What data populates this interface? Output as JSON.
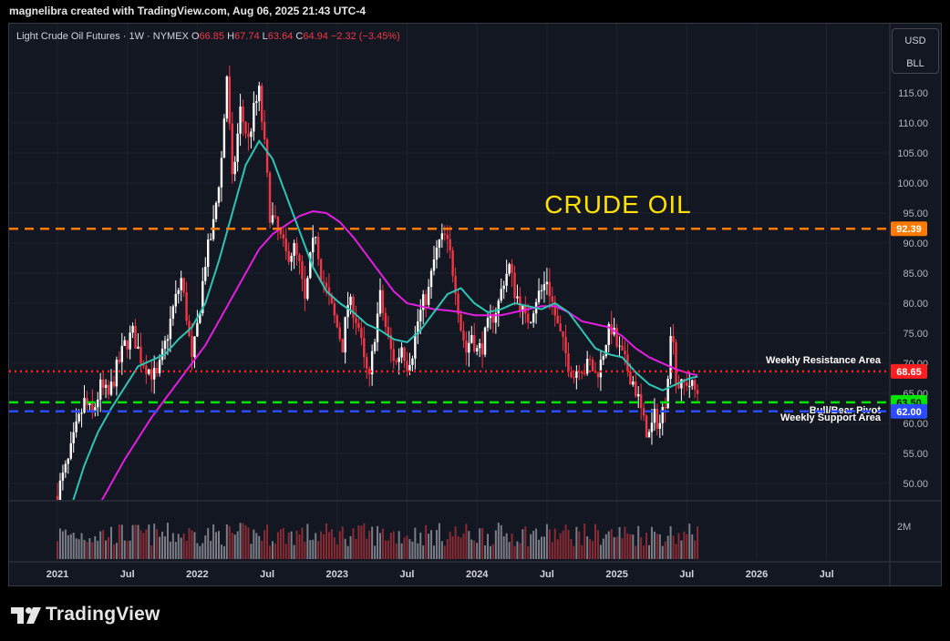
{
  "header": {
    "attribution": "magnelibra created with TradingView.com, Aug 06, 2025 21:43 UTC-4"
  },
  "legend": {
    "symbol": "Light Crude Oil Futures · 1W · NYMEX",
    "o_label": "O",
    "o_value": "66.85",
    "h_label": "H",
    "h_value": "67.74",
    "l_label": "L",
    "l_value": "63.64",
    "c_label": "C",
    "c_value": "64.94",
    "change": "−2.32 (−3.45%)"
  },
  "units": {
    "currency": "USD",
    "unit": "BLL"
  },
  "footer": {
    "brand": "TradingView"
  },
  "colors": {
    "background": "#131722",
    "up": "#ffffff",
    "down": "#f23645",
    "ema_fast": "#2ec4b6",
    "ema_slow": "#e31ee0",
    "level_orange": "#ff7a00",
    "level_red": "#ff1e1e",
    "level_green": "#00e600",
    "level_blue": "#2a4bff",
    "title": "#ffe100"
  },
  "chart_data": {
    "type": "candlestick",
    "title": "CRUDE OIL",
    "y_ticks": [
      "50.00",
      "55.00",
      "60.00",
      "65.00",
      "70.00",
      "75.00",
      "80.00",
      "85.00",
      "90.00",
      "95.00",
      "100.00",
      "105.00",
      "110.00",
      "115.00"
    ],
    "ylim": [
      47.5,
      122.5
    ],
    "x_ticks": [
      {
        "label": "2021",
        "t": 0
      },
      {
        "label": "Jul",
        "t": 26
      },
      {
        "label": "2022",
        "t": 52
      },
      {
        "label": "Jul",
        "t": 78
      },
      {
        "label": "2023",
        "t": 104
      },
      {
        "label": "Jul",
        "t": 130
      },
      {
        "label": "2024",
        "t": 156
      },
      {
        "label": "Jul",
        "t": 182
      },
      {
        "label": "2025",
        "t": 208
      },
      {
        "label": "Jul",
        "t": 234
      },
      {
        "label": "2026",
        "t": 260
      },
      {
        "label": "Jul",
        "t": 286
      }
    ],
    "x_unit": "weeks since Jan 2021",
    "levels": [
      {
        "value": 92.39,
        "label": "92.39",
        "style": "dashed",
        "color": "#ff7a00",
        "text": ""
      },
      {
        "value": 68.65,
        "label": "68.65",
        "style": "dotted",
        "color": "#ff1e1e",
        "text": "Weekly Resistance Area"
      },
      {
        "value": 63.5,
        "label": "63.50",
        "style": "dashed",
        "color": "#00e600",
        "text": "Bull/Bear Pivot"
      },
      {
        "value": 62.0,
        "label": "62.00",
        "style": "dashed",
        "color": "#2a4bff",
        "text": "Weekly Support Area"
      }
    ],
    "close_anchors": [
      [
        0,
        48.5
      ],
      [
        4,
        53.5
      ],
      [
        7,
        59.0
      ],
      [
        10,
        63.5
      ],
      [
        13,
        61.5
      ],
      [
        16,
        66.0
      ],
      [
        19,
        64.5
      ],
      [
        22,
        69.0
      ],
      [
        25,
        73.0
      ],
      [
        28,
        75.0
      ],
      [
        31,
        71.0
      ],
      [
        34,
        69.0
      ],
      [
        37,
        67.5
      ],
      [
        40,
        73.0
      ],
      [
        43,
        79.0
      ],
      [
        46,
        84.0
      ],
      [
        48,
        78.0
      ],
      [
        50,
        70.0
      ],
      [
        52,
        76.0
      ],
      [
        55,
        87.0
      ],
      [
        58,
        93.0
      ],
      [
        61,
        104.0
      ],
      [
        63,
        118.0
      ],
      [
        65,
        100.0
      ],
      [
        68,
        112.0
      ],
      [
        71,
        107.0
      ],
      [
        73,
        112.0
      ],
      [
        75,
        115.0
      ],
      [
        77,
        106.0
      ],
      [
        79,
        95.0
      ],
      [
        82,
        92.0
      ],
      [
        85,
        88.0
      ],
      [
        88,
        89.0
      ],
      [
        90,
        86.0
      ],
      [
        92,
        80.0
      ],
      [
        94,
        87.0
      ],
      [
        96,
        92.0
      ],
      [
        98,
        85.0
      ],
      [
        100,
        82.0
      ],
      [
        102,
        79.0
      ],
      [
        104,
        76.0
      ],
      [
        106,
        73.0
      ],
      [
        108,
        80.0
      ],
      [
        110,
        79.0
      ],
      [
        112,
        76.0
      ],
      [
        114,
        70.0
      ],
      [
        116,
        67.0
      ],
      [
        118,
        75.0
      ],
      [
        120,
        81.0
      ],
      [
        122,
        76.0
      ],
      [
        124,
        72.0
      ],
      [
        126,
        70.0
      ],
      [
        128,
        73.0
      ],
      [
        130,
        70.0
      ],
      [
        132,
        72.0
      ],
      [
        134,
        77.0
      ],
      [
        136,
        80.0
      ],
      [
        138,
        82.0
      ],
      [
        140,
        87.0
      ],
      [
        142,
        90.0
      ],
      [
        144,
        91.0
      ],
      [
        146,
        88.0
      ],
      [
        148,
        83.0
      ],
      [
        150,
        76.0
      ],
      [
        152,
        72.0
      ],
      [
        154,
        75.0
      ],
      [
        156,
        72.0
      ],
      [
        158,
        73.0
      ],
      [
        160,
        76.0
      ],
      [
        162,
        78.0
      ],
      [
        164,
        80.0
      ],
      [
        166,
        84.0
      ],
      [
        168,
        86.0
      ],
      [
        170,
        82.0
      ],
      [
        172,
        80.0
      ],
      [
        174,
        77.0
      ],
      [
        176,
        78.0
      ],
      [
        178,
        81.0
      ],
      [
        180,
        82.0
      ],
      [
        182,
        84.0
      ],
      [
        184,
        80.0
      ],
      [
        186,
        76.0
      ],
      [
        188,
        73.0
      ],
      [
        190,
        70.0
      ],
      [
        192,
        68.0
      ],
      [
        194,
        70.0
      ],
      [
        196,
        69.0
      ],
      [
        198,
        70.0
      ],
      [
        200,
        68.0
      ],
      [
        202,
        70.0
      ],
      [
        204,
        74.0
      ],
      [
        206,
        76.0
      ],
      [
        208,
        73.0
      ],
      [
        210,
        71.0
      ],
      [
        212,
        69.0
      ],
      [
        214,
        67.0
      ],
      [
        216,
        64.0
      ],
      [
        218,
        60.0
      ],
      [
        220,
        58.0
      ],
      [
        222,
        61.0
      ],
      [
        224,
        60.0
      ],
      [
        226,
        64.0
      ],
      [
        228,
        74.0
      ],
      [
        229,
        75.0
      ],
      [
        230,
        67.0
      ],
      [
        232,
        66.0
      ],
      [
        234,
        67.0
      ],
      [
        236,
        66.0
      ],
      [
        238,
        64.9
      ]
    ],
    "ema_fast_anchors": [
      [
        5,
        46.0
      ],
      [
        10,
        53.0
      ],
      [
        15,
        58.5
      ],
      [
        20,
        62.5
      ],
      [
        25,
        66.0
      ],
      [
        30,
        69.5
      ],
      [
        35,
        70.5
      ],
      [
        40,
        71.5
      ],
      [
        45,
        74.0
      ],
      [
        50,
        76.0
      ],
      [
        55,
        80.0
      ],
      [
        60,
        87.0
      ],
      [
        65,
        95.0
      ],
      [
        70,
        103.0
      ],
      [
        75,
        107.0
      ],
      [
        80,
        104.0
      ],
      [
        85,
        98.0
      ],
      [
        90,
        92.0
      ],
      [
        95,
        86.0
      ],
      [
        100,
        82.0
      ],
      [
        105,
        80.0
      ],
      [
        110,
        78.5
      ],
      [
        115,
        76.5
      ],
      [
        120,
        75.5
      ],
      [
        125,
        74.0
      ],
      [
        130,
        73.5
      ],
      [
        135,
        75.5
      ],
      [
        140,
        78.5
      ],
      [
        145,
        81.5
      ],
      [
        150,
        82.5
      ],
      [
        155,
        80.0
      ],
      [
        160,
        78.5
      ],
      [
        165,
        79.0
      ],
      [
        170,
        80.0
      ],
      [
        175,
        79.5
      ],
      [
        180,
        79.0
      ],
      [
        185,
        80.0
      ],
      [
        190,
        78.5
      ],
      [
        195,
        75.5
      ],
      [
        200,
        72.5
      ],
      [
        205,
        71.5
      ],
      [
        210,
        71.0
      ],
      [
        215,
        68.5
      ],
      [
        220,
        66.5
      ],
      [
        225,
        65.5
      ],
      [
        230,
        66.5
      ],
      [
        235,
        67.5
      ],
      [
        238,
        67.8
      ]
    ],
    "ema_slow_anchors": [
      [
        15,
        46.0
      ],
      [
        20,
        50.0
      ],
      [
        25,
        54.0
      ],
      [
        30,
        57.5
      ],
      [
        35,
        61.0
      ],
      [
        40,
        64.0
      ],
      [
        45,
        67.0
      ],
      [
        50,
        70.0
      ],
      [
        55,
        73.0
      ],
      [
        60,
        77.0
      ],
      [
        65,
        81.0
      ],
      [
        70,
        85.0
      ],
      [
        75,
        89.0
      ],
      [
        80,
        91.5
      ],
      [
        85,
        93.0
      ],
      [
        90,
        94.5
      ],
      [
        95,
        95.3
      ],
      [
        100,
        95.0
      ],
      [
        105,
        93.5
      ],
      [
        110,
        91.0
      ],
      [
        115,
        88.0
      ],
      [
        120,
        85.0
      ],
      [
        125,
        82.0
      ],
      [
        130,
        80.0
      ],
      [
        135,
        79.5
      ],
      [
        140,
        79.0
      ],
      [
        145,
        78.8
      ],
      [
        150,
        78.5
      ],
      [
        155,
        78.0
      ],
      [
        160,
        78.0
      ],
      [
        165,
        78.0
      ],
      [
        170,
        78.5
      ],
      [
        175,
        79.0
      ],
      [
        180,
        79.5
      ],
      [
        185,
        79.5
      ],
      [
        190,
        78.5
      ],
      [
        195,
        77.0
      ],
      [
        200,
        76.5
      ],
      [
        205,
        76.0
      ],
      [
        210,
        74.5
      ],
      [
        215,
        72.5
      ],
      [
        220,
        71.0
      ],
      [
        225,
        70.0
      ],
      [
        230,
        69.0
      ],
      [
        235,
        68.3
      ],
      [
        238,
        68.0
      ]
    ],
    "volume_label": "2M"
  }
}
